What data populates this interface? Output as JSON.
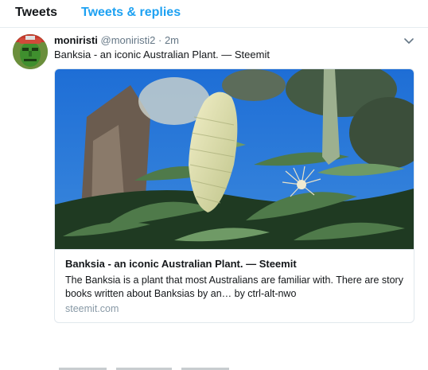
{
  "tabs": {
    "tweets": "Tweets",
    "tweets_replies": "Tweets & replies"
  },
  "tweet": {
    "display_name": "moniristi",
    "handle": "@moniristi2",
    "separator": "·",
    "time": "2m",
    "text": "Banksia - an iconic Australian Plant. — Steemit",
    "avatar_icon": "avatar-green-face-icon",
    "menu_icon": "chevron-down-icon"
  },
  "card": {
    "title": "Banksia - an iconic Australian Plant. — Steemit",
    "description": "The Banksia is a plant that most Australians are familiar with. There are story books written about Banksias by an… by ctrl-alt-nwo",
    "domain": "steemit.com"
  },
  "colors": {
    "accent": "#1da1f2",
    "text": "#14171a",
    "muted": "#657786",
    "border": "#e1e8ed",
    "sky": "#1f6fd1"
  }
}
